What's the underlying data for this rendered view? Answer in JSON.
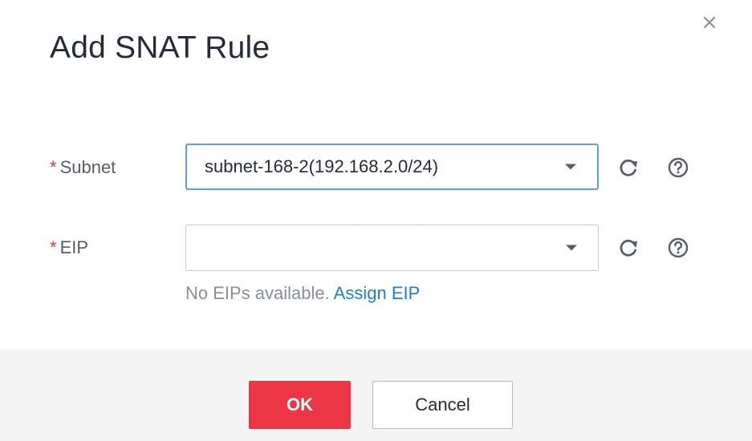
{
  "dialog": {
    "title": "Add SNAT Rule",
    "close_icon": "close-icon"
  },
  "form": {
    "subnet": {
      "required_mark": "*",
      "label": "Subnet",
      "value": "subnet-168-2(192.168.2.0/24)",
      "refresh_icon": "refresh-icon",
      "help_icon": "help-icon"
    },
    "eip": {
      "required_mark": "*",
      "label": "EIP",
      "value": "",
      "hint_text": "No EIPs available.",
      "hint_link": "Assign EIP",
      "refresh_icon": "refresh-icon",
      "help_icon": "help-icon"
    }
  },
  "footer": {
    "ok_label": "OK",
    "cancel_label": "Cancel"
  },
  "colors": {
    "required": "#e0323f",
    "link": "#1a7fe0",
    "ok_button": "#ec3545",
    "focus_border": "#5e9be8",
    "footer_bg": "#f4f4f4"
  }
}
